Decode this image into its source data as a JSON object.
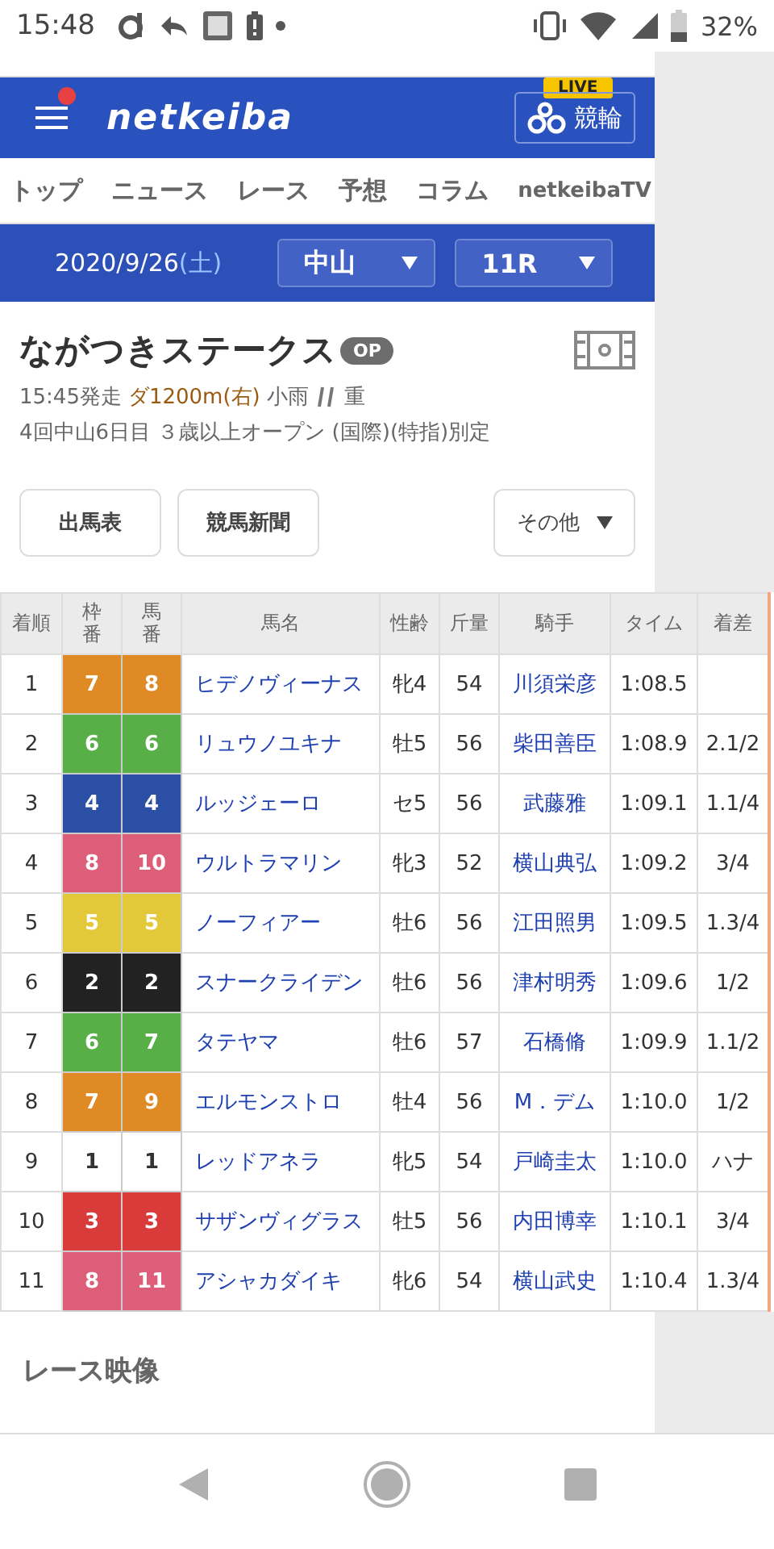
{
  "status_bar": {
    "time": "15:48",
    "battery": "32%"
  },
  "header": {
    "logo": "netkeiba",
    "menu_badge": true,
    "live_badge": "LIVE",
    "keirin_button": "競輪"
  },
  "nav": {
    "items": [
      {
        "label": "トップ"
      },
      {
        "label": "ニュース"
      },
      {
        "label": "レース"
      },
      {
        "label": "予想"
      },
      {
        "label": "コラム"
      },
      {
        "label": "netkeibaTV"
      }
    ]
  },
  "date_bar": {
    "date": "2020/9/26",
    "weekday": "(土)",
    "venue": "中山",
    "race": "11R"
  },
  "race": {
    "title": "ながつきステークス",
    "grade": "OP",
    "start": "15:45発走",
    "course": "ダ1200m(右)",
    "weather": "小雨",
    "going": "重",
    "info": "4回中山6日目 ３歳以上オープン (国際)(特指)別定"
  },
  "buttons": [
    {
      "label": "出馬表"
    },
    {
      "label": "競馬新聞"
    },
    {
      "label": "その他"
    }
  ],
  "table": {
    "columns": [
      "着順",
      "枠番",
      "馬番",
      "馬名",
      "性齢",
      "斤量",
      "騎手",
      "タイム",
      "着差"
    ],
    "rows": [
      {
        "rank": "1",
        "frame": "7",
        "number": "8",
        "color": "#e08a26",
        "horse": "ヒデノヴィーナス",
        "sex_age": "牝4",
        "weight": "54",
        "jockey": "川須栄彦",
        "time": "1:08.5"
      },
      {
        "rank": "2",
        "frame": "6",
        "number": "6",
        "color": "#58ae47",
        "horse": "リュウノユキナ",
        "sex_age": "牡5",
        "weight": "56",
        "jockey": "柴田善臣",
        "time": "1:08.9",
        "margin": "2.1/2"
      },
      {
        "rank": "3",
        "frame": "4",
        "number": "4",
        "color": "#2b4fa5",
        "horse": "ルッジェーロ",
        "sex_age": "セ5",
        "weight": "56",
        "jockey": "武藤雅",
        "time": "1:09.1",
        "margin": "1.1/4"
      },
      {
        "rank": "4",
        "frame": "8",
        "number": "10",
        "color": "#dd5e78",
        "horse": "ウルトラマリン",
        "sex_age": "牝3",
        "weight": "52",
        "jockey": "横山典弘",
        "time": "1:09.2",
        "margin": "3/4"
      },
      {
        "rank": "5",
        "frame": "5",
        "number": "5",
        "color": "#e3c93a",
        "horse": "ノーフィアー",
        "sex_age": "牡6",
        "weight": "56",
        "jockey": "江田照男",
        "time": "1:09.5",
        "margin": "1.3/4"
      },
      {
        "rank": "6",
        "frame": "2",
        "number": "2",
        "color": "#222222",
        "horse": "スナークライデン",
        "sex_age": "牡6",
        "weight": "56",
        "jockey": "津村明秀",
        "time": "1:09.6",
        "margin": "1/2"
      },
      {
        "rank": "7",
        "frame": "6",
        "number": "7",
        "color": "#58ae47",
        "horse": "タテヤマ",
        "sex_age": "牡6",
        "weight": "57",
        "jockey": "石橋脩",
        "time": "1:09.9",
        "margin": "1.1/2"
      },
      {
        "rank": "8",
        "frame": "7",
        "number": "9",
        "color": "#e08a26",
        "horse": "エルモンストロ",
        "sex_age": "牡4",
        "weight": "56",
        "jockey": "M．デム",
        "time": "1:10.0",
        "margin": "1/2"
      },
      {
        "rank": "9",
        "frame": "1",
        "number": "1",
        "color": "#ffffff",
        "horse": "レッドアネラ",
        "sex_age": "牝5",
        "weight": "54",
        "jockey": "戸崎圭太",
        "time": "1:10.0",
        "margin": "ハナ"
      },
      {
        "rank": "10",
        "frame": "3",
        "number": "3",
        "color": "#d93a3a",
        "horse": "サザンヴィグラス",
        "sex_age": "牡5",
        "weight": "56",
        "jockey": "内田博幸",
        "time": "1:10.1",
        "margin": "3/4"
      },
      {
        "rank": "11",
        "frame": "8",
        "number": "11",
        "color": "#dd5e78",
        "horse": "アシャカダイキ",
        "sex_age": "牝6",
        "weight": "54",
        "jockey": "横山武史",
        "time": "1:10.4",
        "margin": "1.3/4"
      }
    ]
  },
  "section_title": "レース映像"
}
